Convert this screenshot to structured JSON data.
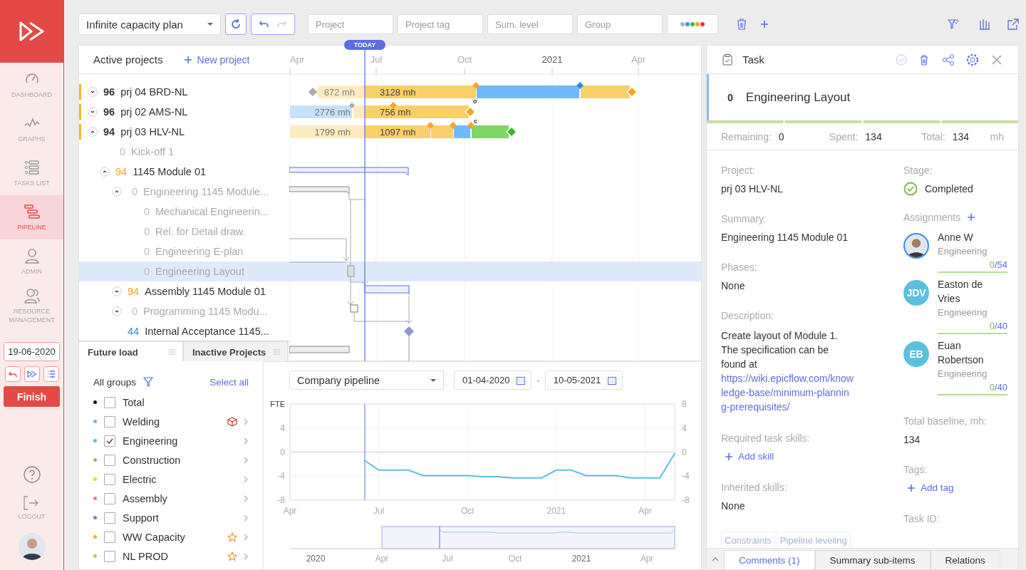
{
  "sidebar": {
    "nav": [
      {
        "label": "DASHBOARD",
        "selected": false
      },
      {
        "label": "GRAPHS",
        "selected": false
      },
      {
        "label": "TASKS LIST",
        "selected": false
      },
      {
        "label": "PIPELINE",
        "selected": true
      },
      {
        "label": "ADMIN",
        "selected": false
      },
      {
        "label": "RESOURCE MANAGEMENT",
        "selected": false
      }
    ],
    "date": "19-06-2020",
    "finish": "Finish",
    "logout": "LOGOUT"
  },
  "toolbar": {
    "plan": "Infinite capacity plan",
    "filters": [
      {
        "placeholder": "Project"
      },
      {
        "placeholder": "Project tag"
      },
      {
        "placeholder": "Sum. level"
      },
      {
        "placeholder": "Group"
      }
    ],
    "color_filter": [
      {
        "color": "#b0b0b0"
      },
      {
        "color": "#3d8ef0"
      },
      {
        "color": "#2fbf3a"
      },
      {
        "color": "#f5a623"
      },
      {
        "color": "#e8353b"
      }
    ]
  },
  "gantt": {
    "title": "Active projects",
    "new_project": "New project",
    "today": "TODAY",
    "timeline": [
      {
        "label": "Apr",
        "kind": "month"
      },
      {
        "label": "Jul",
        "kind": "month"
      },
      {
        "label": "Oct",
        "kind": "month"
      },
      {
        "label": "2021",
        "kind": "year"
      },
      {
        "label": "Apr",
        "kind": "month"
      }
    ],
    "rows": [
      {
        "kind": "project",
        "score": "96",
        "color": "#333333",
        "name": "prj 04 BRD-NL",
        "dimmed": false,
        "expanded": false,
        "selected": false,
        "bars": [
          {
            "label": "872 mh"
          },
          {
            "label": "3128 mh"
          }
        ]
      },
      {
        "kind": "project",
        "score": "96",
        "color": "#333333",
        "name": "prj 02 AMS-NL",
        "dimmed": false,
        "expanded": false,
        "selected": false,
        "bars": [
          {
            "label": "2776 mh"
          },
          {
            "label": "756 mh"
          }
        ],
        "flag": "o"
      },
      {
        "kind": "project",
        "score": "94",
        "color": "#333333",
        "name": "prj 03 HLV-NL",
        "dimmed": false,
        "expanded": true,
        "selected": false,
        "bars": [
          {
            "label": "1799 mh"
          },
          {
            "label": "1097 mh"
          }
        ],
        "flag": "c",
        "children": [
          {
            "kind": "task",
            "score": "0",
            "color": "#bbbbbb",
            "name": "Kick-off 1",
            "dimmed": true,
            "selected": false
          },
          {
            "kind": "task",
            "score": "94",
            "color": "#f5a623",
            "name": "1145 Module 01",
            "dimmed": false,
            "expanded": true,
            "selected": false,
            "children": [
              {
                "kind": "task",
                "score": "0",
                "color": "#bbbbbb",
                "name": "Engineering 1145 Module...",
                "dimmed": true,
                "expanded": true,
                "selected": false,
                "children": [
                  {
                    "kind": "task",
                    "score": "0",
                    "color": "#bbbbbb",
                    "name": "Mechanical Engineerin...",
                    "dimmed": true,
                    "selected": false
                  },
                  {
                    "kind": "task",
                    "score": "0",
                    "color": "#bbbbbb",
                    "name": "Rel. for Detail draw.",
                    "dimmed": true,
                    "selected": false
                  },
                  {
                    "kind": "task",
                    "score": "0",
                    "color": "#bbbbbb",
                    "name": "Engineering E-plan",
                    "dimmed": true,
                    "selected": false
                  },
                  {
                    "kind": "task",
                    "score": "0",
                    "color": "#bbbbbb",
                    "name": "Engineering Layout",
                    "dimmed": true,
                    "selected": true
                  }
                ]
              },
              {
                "kind": "task",
                "score": "94",
                "color": "#f5a623",
                "name": "Assembly 1145 Module 01",
                "dimmed": false,
                "expanded": false,
                "selected": false
              },
              {
                "kind": "task",
                "score": "0",
                "color": "#bbbbbb",
                "name": "Programming 1145 Modu...",
                "dimmed": true,
                "expanded": false,
                "selected": false
              },
              {
                "kind": "task",
                "score": "44",
                "color": "#3b82f6",
                "name": "Internal Acceptance 1145...",
                "dimmed": false,
                "selected": false
              }
            ]
          }
        ]
      }
    ]
  },
  "load": {
    "tabs": [
      {
        "label": "Future load",
        "selected": true
      },
      {
        "label": "Inactive Projects",
        "selected": false
      }
    ],
    "groups_title": "All groups",
    "select_all": "Select all",
    "groups": [
      {
        "name": "Total",
        "color": "#111111",
        "checked": false,
        "expandable": false,
        "flagged": false,
        "favorite": false
      },
      {
        "name": "Welding",
        "color": "#74b0f5",
        "checked": false,
        "expandable": true,
        "flagged": true,
        "favorite": false
      },
      {
        "name": "Engineering",
        "color": "#5bc0de",
        "checked": true,
        "expandable": true,
        "flagged": false,
        "favorite": false
      },
      {
        "name": "Construction",
        "color": "#8bc36a",
        "checked": false,
        "expandable": true,
        "flagged": false,
        "favorite": false
      },
      {
        "name": "Electric",
        "color": "#f5d000",
        "checked": false,
        "expandable": true,
        "flagged": false,
        "favorite": false
      },
      {
        "name": "Assembly",
        "color": "#e07a7a",
        "checked": false,
        "expandable": true,
        "flagged": false,
        "favorite": false
      },
      {
        "name": "Support",
        "color": "#7a7ad6",
        "checked": false,
        "expandable": true,
        "flagged": false,
        "favorite": false
      },
      {
        "name": "WW Capacity",
        "color": "#f5b400",
        "checked": false,
        "expandable": true,
        "flagged": false,
        "favorite": true
      },
      {
        "name": "NL PROD",
        "color": "#a6d35a",
        "checked": false,
        "expandable": true,
        "flagged": false,
        "favorite": true
      }
    ]
  },
  "forecast": {
    "view": "Company pipeline",
    "date_from": "01-04-2020",
    "date_separator": "-",
    "date_to": "10-05-2021",
    "right_axis": [
      "8",
      "4",
      "0",
      "-4",
      "-8"
    ],
    "chart_data": {
      "type": "line",
      "grid": true,
      "ylabel": "FTE",
      "ylim": [
        -8,
        8
      ],
      "yticks": [
        -8,
        -4,
        0,
        4
      ],
      "categories": [
        "Apr",
        null,
        null,
        null,
        null,
        null,
        "Jul",
        null,
        null,
        null,
        null,
        null,
        "Oct",
        null,
        null,
        null,
        null,
        null,
        "2021",
        null,
        null,
        null,
        null,
        null,
        "Apr",
        null,
        null
      ],
      "series": [
        {
          "color": "#5bc0de",
          "values": [
            null,
            null,
            null,
            null,
            null,
            -1.3,
            -3,
            -3,
            -3,
            -3.9,
            -3.9,
            -3.9,
            -3.9,
            -4.1,
            -4.1,
            -4.3,
            -4.3,
            -4.3,
            -3,
            -3,
            -3.9,
            -3.9,
            -3.9,
            -4.3,
            -4.3,
            -4.3,
            -0.2
          ]
        }
      ]
    },
    "navigator": [
      "2020",
      "Apr",
      "Jul",
      "Oct",
      "2021",
      "Apr"
    ]
  },
  "task": {
    "header": "Task",
    "score": "0",
    "title": "Engineering Layout",
    "progress": {
      "level": 1
    },
    "stats": [
      {
        "label": "Remaining:",
        "value": "0"
      },
      {
        "label": "Spent:",
        "value": "134"
      },
      {
        "label": "Total:",
        "value": "134"
      }
    ],
    "unit": "mh",
    "fields": [
      {
        "kind": "text",
        "label": "Project:",
        "value": "prj 03 HLV-NL"
      },
      {
        "kind": "text",
        "label": "Summary:",
        "value": "Engineering 1145 Module 01"
      },
      {
        "kind": "text",
        "label": "Phases:",
        "value": "None"
      },
      {
        "kind": "description",
        "label": "Description:",
        "value": "Create layout of Module 1. The specification can be found at",
        "link": "https://wiki.epicflow.com/knowledge-base/minimum-planning-prerequisites/"
      },
      {
        "kind": "action",
        "label": "Required task skills:",
        "value": "Add skill"
      },
      {
        "kind": "text",
        "label": "Inherited skills:",
        "value": "None"
      }
    ],
    "sub_tabs": [
      "Constraints",
      "Pipeline leveling"
    ],
    "stage": {
      "label": "Stage:",
      "value": "Completed"
    },
    "assignments": {
      "label": "Assignments",
      "people": [
        {
          "name": "Anne W",
          "group": "Engineering",
          "done": "0",
          "capacity": "/54"
        },
        {
          "kind": "initials",
          "initials": "JDV",
          "name": "Easton de Vries",
          "group": "Engineering",
          "done": "0",
          "capacity": "/40"
        },
        {
          "kind": "initials",
          "initials": "EB",
          "name": "Euan Robertson",
          "group": "Engineering",
          "done": "0",
          "capacity": "/40"
        }
      ]
    },
    "side_fields": [
      {
        "kind": "text",
        "label": "Total baseline, mh:",
        "value": "134"
      },
      {
        "kind": "action",
        "label": "Tags:",
        "value": "Add tag"
      },
      {
        "kind": "text",
        "label": "Task ID:"
      }
    ],
    "tabs": [
      {
        "label": "Comments (1)",
        "selected": true
      },
      {
        "label": "Summary sub-items",
        "selected": false
      },
      {
        "label": "Relations",
        "selected": false
      }
    ]
  }
}
